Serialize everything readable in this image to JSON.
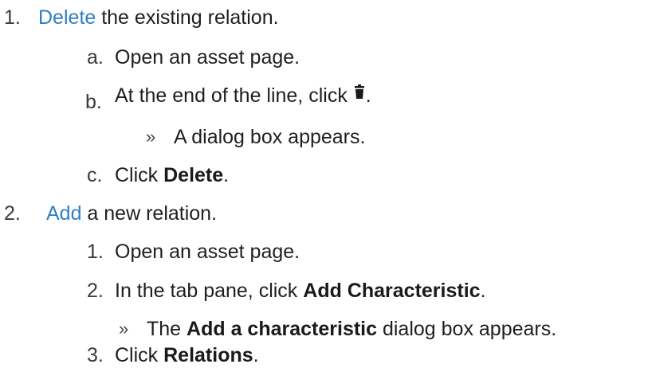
{
  "steps": [
    {
      "number": "1.",
      "link_text": "Delete",
      "rest_text": " the existing relation.",
      "substeps": [
        {
          "marker": "a.",
          "text": "Open an asset page."
        },
        {
          "marker": "b.",
          "text_before": "At the end of the line, click ",
          "icon": "trash-icon",
          "text_after": "."
        },
        {
          "marker": "»",
          "text": "A dialog box appears.",
          "type": "result"
        },
        {
          "marker": "c.",
          "text_before": "Click ",
          "bold": "Delete",
          "text_after": "."
        }
      ]
    },
    {
      "number": "2.",
      "link_text": "Add",
      "rest_text": " a new relation.",
      "substeps": [
        {
          "marker": "1.",
          "text": "Open an asset page."
        },
        {
          "marker": "2.",
          "text_before": "In the tab pane, click ",
          "bold": "Add Characteristic",
          "text_after": "."
        },
        {
          "marker": "»",
          "text_before": "The ",
          "bold": "Add a characteristic",
          "text_after": " dialog box appears.",
          "type": "result"
        },
        {
          "marker": "3.",
          "text_before": "Click ",
          "bold": "Relations",
          "text_after": "."
        }
      ]
    }
  ],
  "colors": {
    "link": "#2f7fc1",
    "text": "#1f1f1f"
  }
}
